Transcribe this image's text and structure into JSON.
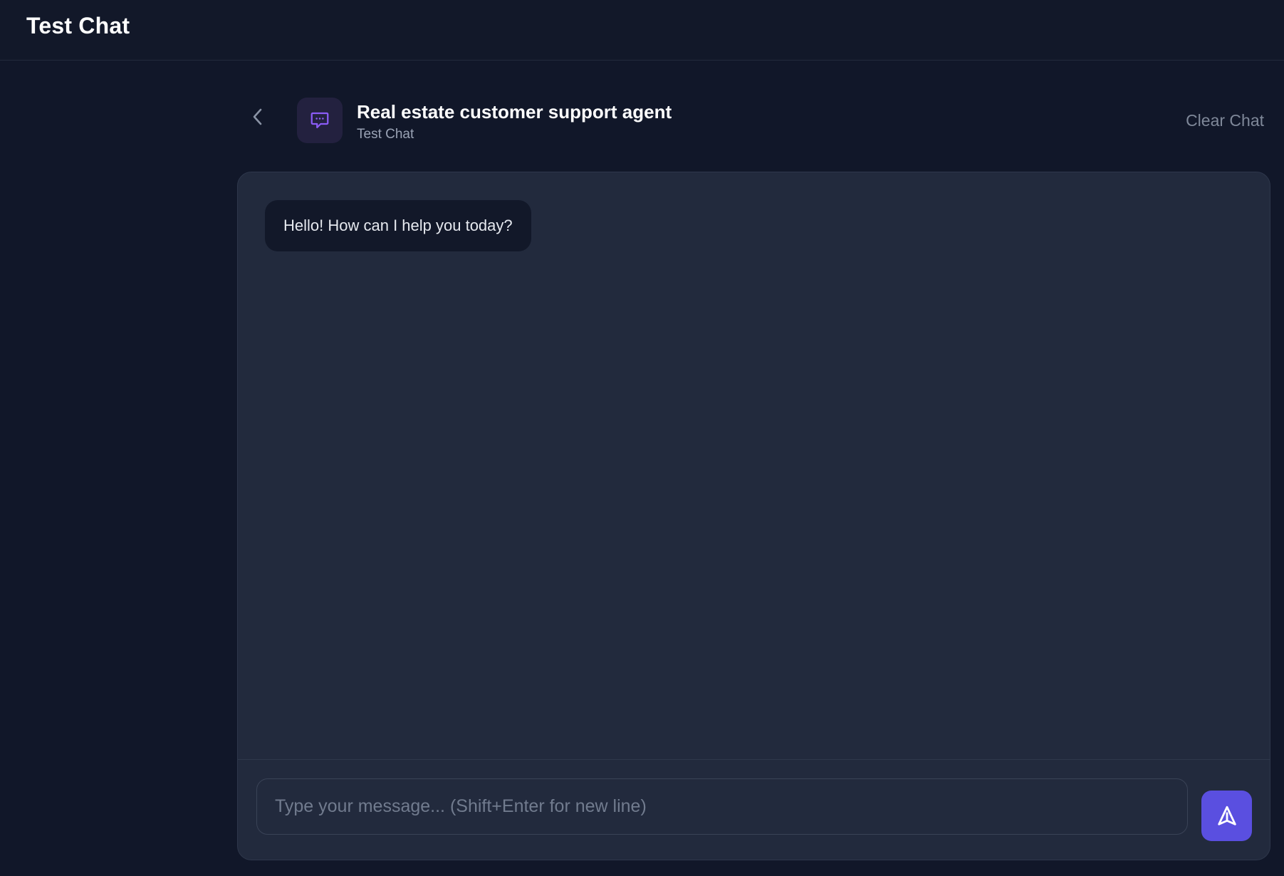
{
  "app": {
    "title": "Test Chat"
  },
  "chat_header": {
    "back_icon": "chevron-left-icon",
    "avatar_icon": "chat-bubble-dots-icon",
    "agent_name": "Real estate customer support agent",
    "subtitle": "Test Chat",
    "clear_label": "Clear Chat"
  },
  "messages": [
    {
      "role": "assistant",
      "text": "Hello! How can I help you today?"
    }
  ],
  "composer": {
    "value": "",
    "placeholder": "Type your message... (Shift+Enter for new line)",
    "send_icon": "send-arrow-icon"
  },
  "colors": {
    "background": "#111729",
    "panel": "#222a3d",
    "accent": "#5a4fe0",
    "avatar_bg": "#23213f",
    "avatar_icon": "#8b5cf6"
  }
}
